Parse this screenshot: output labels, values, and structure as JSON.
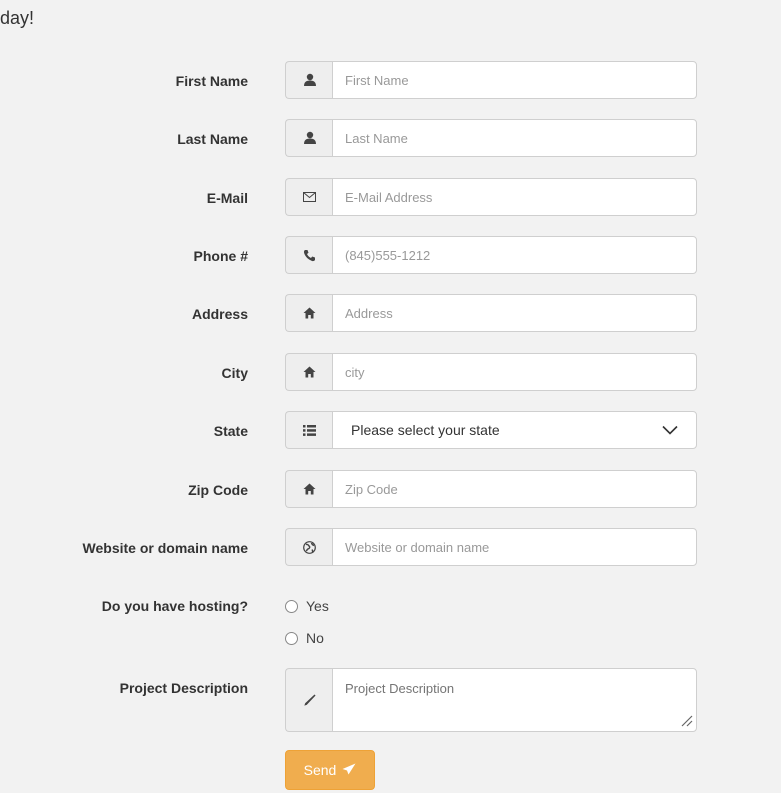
{
  "heading": "day!",
  "fields": [
    {
      "label": "First Name",
      "icon": "user-icon",
      "placeholder": "First Name"
    },
    {
      "label": "Last Name",
      "icon": "user-icon",
      "placeholder": "Last Name"
    },
    {
      "label": "E-Mail",
      "icon": "envelope-icon",
      "placeholder": "E-Mail Address"
    },
    {
      "label": "Phone #",
      "icon": "phone-icon",
      "placeholder": "(845)555-1212"
    },
    {
      "label": "Address",
      "icon": "home-icon",
      "placeholder": "Address"
    },
    {
      "label": "City",
      "icon": "home-icon",
      "placeholder": "city"
    },
    {
      "label": "State",
      "icon": "list-icon",
      "selected": "Please select your state"
    },
    {
      "label": "Zip Code",
      "icon": "home-icon",
      "placeholder": "Zip Code"
    },
    {
      "label": "Website or domain name",
      "icon": "globe-icon",
      "placeholder": "Website or domain name"
    }
  ],
  "hosting": {
    "label": "Do you have hosting?",
    "options": [
      "Yes",
      "No"
    ]
  },
  "description": {
    "label": "Project Description",
    "icon": "pencil-icon",
    "placeholder": "Project Description"
  },
  "send_button": {
    "label": "Send",
    "icon": "send-icon",
    "color": "#f0ad4e"
  }
}
